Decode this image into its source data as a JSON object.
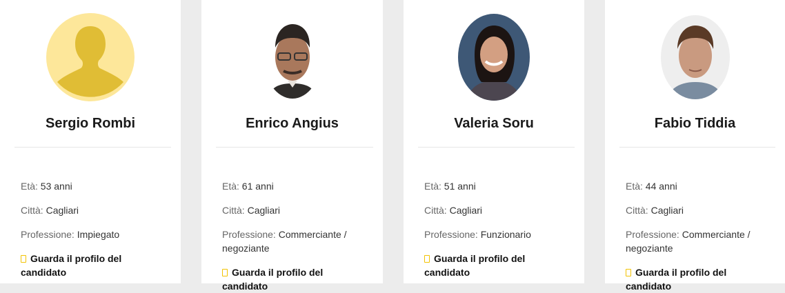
{
  "candidates": [
    {
      "name": "Sergio Rombi",
      "age_label": "Età:",
      "age_value": "53 anni",
      "city_label": "Città:",
      "city_value": "Cagliari",
      "job_label": "Professione:",
      "job_value": "Impiegato",
      "profile_link": "Guarda il profilo del candidato",
      "avatar": "placeholder-person-icon"
    },
    {
      "name": "Enrico Angius",
      "age_label": "Età:",
      "age_value": "61 anni",
      "city_label": "Città:",
      "city_value": "Cagliari",
      "job_label": "Professione:",
      "job_value": "Commerciante / negoziante",
      "profile_link": "Guarda il profilo del candidato",
      "avatar": "photo"
    },
    {
      "name": "Valeria Soru",
      "age_label": "Età:",
      "age_value": "51 anni",
      "city_label": "Città:",
      "city_value": "Cagliari",
      "job_label": "Professione:",
      "job_value": "Funzionario",
      "profile_link": "Guarda il profilo del candidato",
      "avatar": "photo"
    },
    {
      "name": "Fabio Tiddia",
      "age_label": "Età:",
      "age_value": "44 anni",
      "city_label": "Città:",
      "city_value": "Cagliari",
      "job_label": "Professione:",
      "job_value": "Commerciante / negoziante",
      "profile_link": "Guarda il profilo del candidato",
      "avatar": "photo"
    }
  ],
  "colors": {
    "page_bg": "#ececec",
    "card_bg": "#ffffff",
    "accent_yellow": "#f2c200",
    "placeholder_bg": "#fde79a",
    "placeholder_fg": "#e0bd35"
  }
}
